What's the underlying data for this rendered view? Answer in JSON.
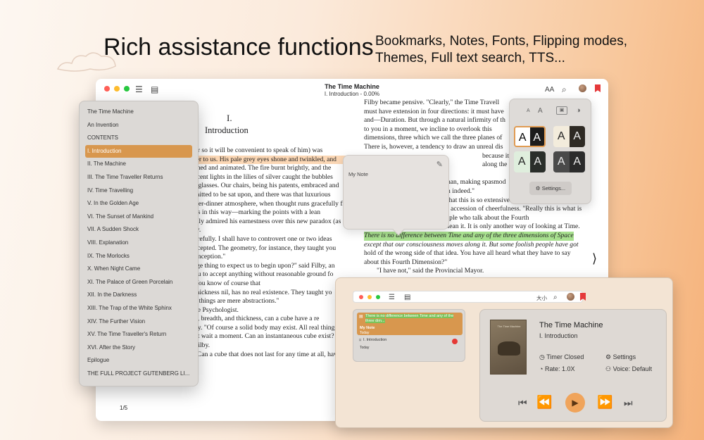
{
  "headline": "Rich assistance functions",
  "subheadline": [
    "Bookmarks, Notes, Fonts, Flipping modes,",
    "Themes, Full text search, TTS..."
  ],
  "reader": {
    "title": "The Time Machine",
    "subtitle": "I. Introduction - 0.00%",
    "font_size_icon": "AA",
    "page_number": "1/5",
    "next_arrow": "⟩",
    "chapter_number": "I.",
    "chapter_title": "Introduction",
    "left_lines": [
      "or so it will be convenient to speak of him) was",
      "ler to us. His pale grey eyes shone and twinkled, and",
      "shed and animated. The fire burnt brightly, and the",
      "scent lights in the lilies of silver caught the bubbles",
      "r glasses. Our chairs, being his patents, embraced and",
      "mitted to be sat upon, and there was that luxurious",
      "fter-dinner atmosphere, when thought runs gracefully free of the trammels of",
      "us in this way—marking the points with a lean",
      "sily admired his earnestness over this new paradox (as",
      "ty.",
      "arefully. I shall have to controvert one or two ideas",
      "ccepted. The geometry, for instance, they taught you",
      "onception.\"",
      "rge thing to expect us to begin upon?\" said Filby, an",
      "ou to accept anything without reasonable ground fo",
      "You know of course that",
      "thickness nil, has no real existence. They taught yo",
      "e things are mere abstractions.\"",
      "he Psychologist.",
      "h, breadth, and thickness, can a cube have a re",
      "by. \"Of course a solid body may exist. All real thing",
      "ut wait a moment. Can an instantaneous cube exist?",
      "Filby.",
      "\"Can a cube that does not last for any time at all, have a real existence?\""
    ],
    "right_lines": [
      "Filby became pensive. \"Clearly,\" the Time Travell",
      "must have extension in four directions: it must have",
      "and—Duration. But through a natural infirmity of th",
      "to you in a moment, we incline to overlook this",
      "dimensions, three which we call the three planes of",
      "There is, however, a tendency to draw an unreal dis",
      "because it happens th",
      "along the latter from",
      "nan, making spasmod",
      "n indeed.\"",
      "that this is so extensively overlooked,\" continued",
      "t accession of cheerfulness. \"Really this is what is",
      "n, though some people who talk about the Fourth",
      "Dimension do not know they mean it. It is only another way of looking at Time.",
      "There is no difference between Time and any of the three dimensions of Space",
      "except that our consciousness moves along it. But some foolish people have got",
      "hold of the wrong side of that idea. You have all heard what they have to say",
      "about this Fourth Dimension?\"",
      "\"I have not,\" said the Provincial Mayor."
    ]
  },
  "toc": {
    "items": [
      "The Time Machine",
      "An Invention",
      "CONTENTS",
      "I. Introduction",
      "II. The Machine",
      "III. The Time Traveller Returns",
      "IV. Time Travelling",
      "V. In the Golden Age",
      "VI. The Sunset of Mankind",
      "VII. A Sudden Shock",
      "VIII. Explanation",
      "IX. The Morlocks",
      "X. When Night Came",
      "XI. The Palace of Green Porcelain",
      "XII. In the Darkness",
      "XIII. The Trap of the White Sphinx",
      "XIV. The Further Vision",
      "XV. The Time Traveller's Return",
      "XVI. After the Story",
      "Epilogue",
      "THE FULL PROJECT GUTENBERG LI..."
    ],
    "active_index": 3
  },
  "note_popup": {
    "label": "My Note"
  },
  "theme_popover": {
    "font_small": "A",
    "font_large": "A",
    "letter": "A",
    "settings_label": "Settings..."
  },
  "mini_toolbar": {
    "font_size_icon": "大小"
  },
  "notes_panel": {
    "quote_highlight": "There is no",
    "quote_rest": "difference between Time and any of the three dim...",
    "note_title": "My Note",
    "note_date": "Today",
    "bookmark_label": "I. Introduction",
    "bookmark_date": "Today"
  },
  "player": {
    "cover_text": "The Time Machine",
    "title": "The Time Machine",
    "chapter": "I. Introduction",
    "timer": "Timer Closed",
    "settings": "Settings",
    "rate": "Rate: 1.0X",
    "voice": "Voice: Default"
  },
  "colors": {
    "accent": "#d8974e",
    "highlight_orange": "#fbd7b5",
    "highlight_green": "#a8e08f",
    "bookmark_red": "#e5393b",
    "play_button": "#f0a45b"
  }
}
